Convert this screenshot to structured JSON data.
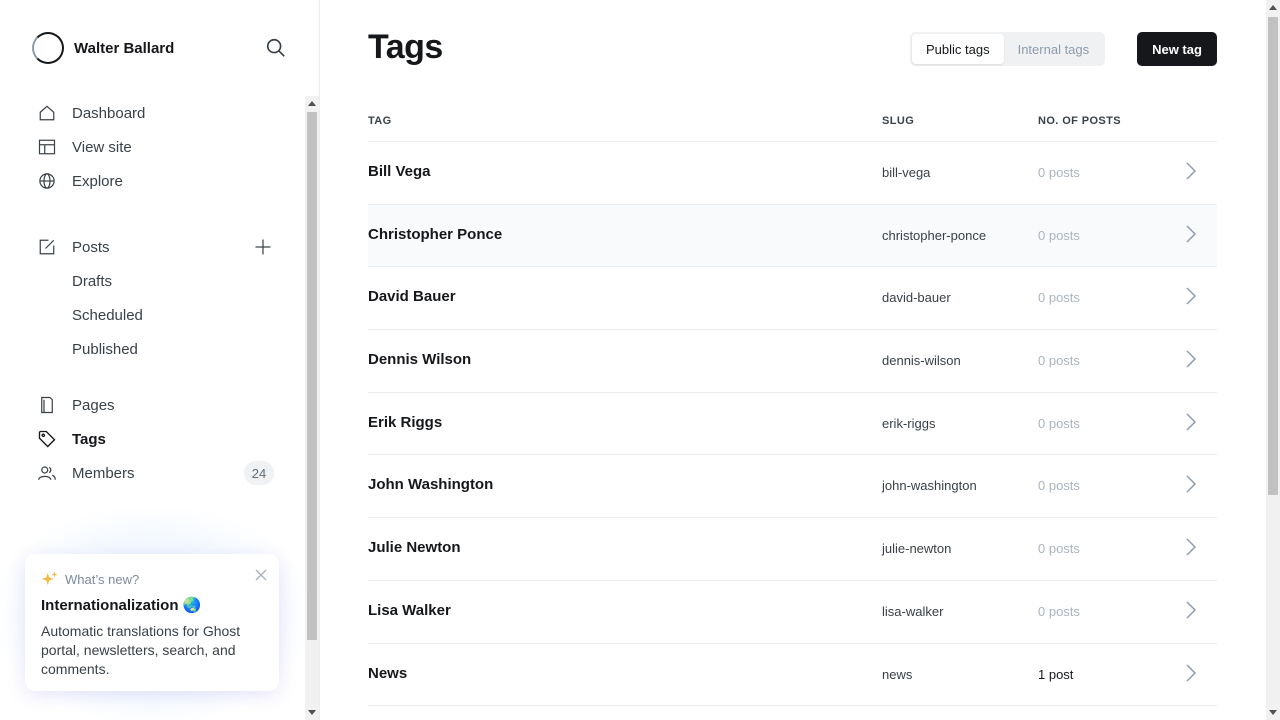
{
  "brand": {
    "name": "Walter Ballard"
  },
  "nav": {
    "dashboard": "Dashboard",
    "view_site": "View site",
    "explore": "Explore",
    "posts": "Posts",
    "drafts": "Drafts",
    "scheduled": "Scheduled",
    "published": "Published",
    "pages": "Pages",
    "tags": "Tags",
    "members": "Members",
    "members_count": "24"
  },
  "whats_new": {
    "kicker": "What’s new?",
    "title": "Internationalization 🌏",
    "description": "Automatic translations for Ghost portal, newsletters, search, and comments."
  },
  "header": {
    "title": "Tags",
    "public_tab": "Public tags",
    "internal_tab": "Internal tags",
    "new_tag": "New tag"
  },
  "table": {
    "columns": [
      "TAG",
      "SLUG",
      "NO. OF POSTS"
    ],
    "rows": [
      {
        "name": "Bill Vega",
        "slug": "bill-vega",
        "count": "0 posts"
      },
      {
        "name": "Christopher Ponce",
        "slug": "christopher-ponce",
        "count": "0 posts"
      },
      {
        "name": "David Bauer",
        "slug": "david-bauer",
        "count": "0 posts"
      },
      {
        "name": "Dennis Wilson",
        "slug": "dennis-wilson",
        "count": "0 posts"
      },
      {
        "name": "Erik Riggs",
        "slug": "erik-riggs",
        "count": "0 posts"
      },
      {
        "name": "John Washington",
        "slug": "john-washington",
        "count": "0 posts"
      },
      {
        "name": "Julie Newton",
        "slug": "julie-newton",
        "count": "0 posts"
      },
      {
        "name": "Lisa Walker",
        "slug": "lisa-walker",
        "count": "0 posts"
      },
      {
        "name": "News",
        "slug": "news",
        "count": "1 post"
      }
    ]
  },
  "colors": {
    "accent": "#15171a",
    "muted": "#abb4be",
    "border": "#ebeef0"
  }
}
